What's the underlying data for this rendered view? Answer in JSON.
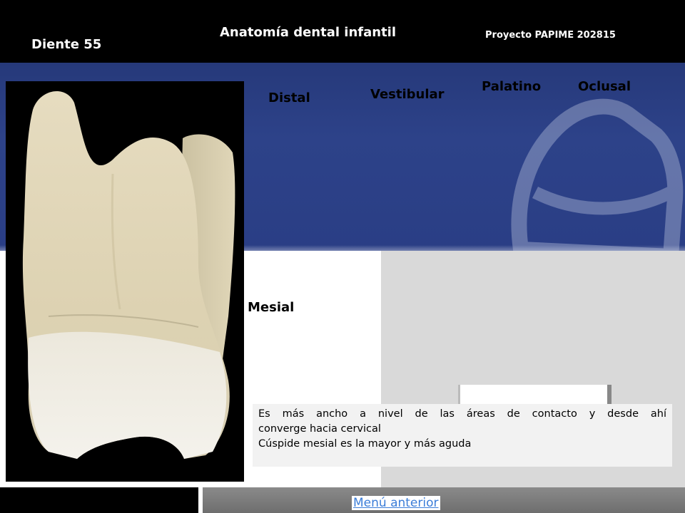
{
  "header": {
    "tooth_id": "Diente 55",
    "title": "Anatomía dental  infantil",
    "project": "Proyecto  PAPIME 202815"
  },
  "views": {
    "distal": "Distal",
    "vestibular": "Vestibular",
    "palatino": "Palatino",
    "oclusal": "Oclusal",
    "mesial": "Mesial"
  },
  "description": {
    "line1": "Es más ancho a nivel de las áreas de contacto y desde ahí",
    "line2": "converge hacia cervical",
    "line3": " Cúspide mesial es la mayor y más aguda"
  },
  "footer": {
    "link_label": "Menú anterior"
  },
  "colors": {
    "band_blue": "#2d4289",
    "link_blue": "#3b7dd8"
  },
  "icons": {
    "watermark": "tooth-watermark-icon"
  }
}
